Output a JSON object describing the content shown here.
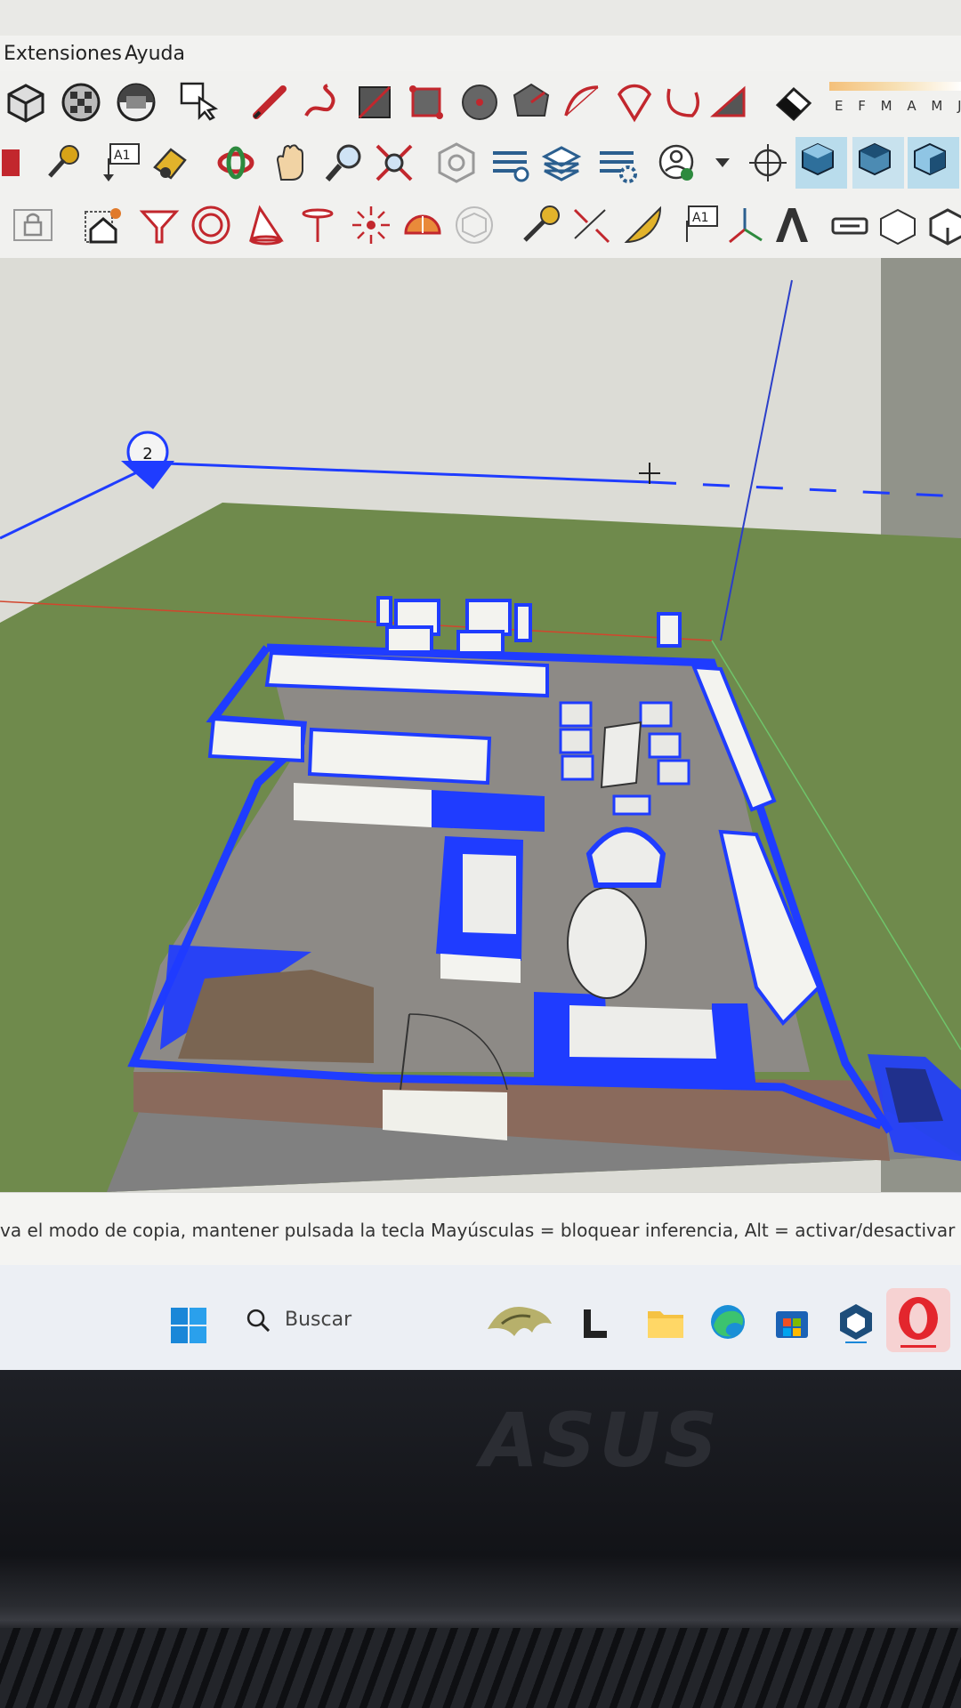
{
  "menu": {
    "items": [
      "Extensiones",
      "Ayuda"
    ]
  },
  "toolbars": {
    "month_labels": "E F M A M J",
    "row1_icons": [
      "section-box-icon",
      "materials-icon",
      "styles-icon",
      "select-icon",
      "pencil-icon",
      "freehand-icon",
      "rectangle-icon",
      "rotated-rectangle-icon",
      "circle-icon",
      "polygon-icon",
      "arc-icon",
      "pie-icon",
      "two-point-arc-icon",
      "three-point-arc-icon",
      "eraser-icon"
    ],
    "row2_icons": [
      "paint-bucket-icon",
      "text-icon",
      "paint-icon",
      "orbit-icon",
      "pan-icon",
      "zoom-icon",
      "zoom-extents-icon",
      "warehouse-icon",
      "layers-icon",
      "extension-icon",
      "settings-icon",
      "user-account-icon",
      "camera-icon",
      "iso-view-icon",
      "top-view-icon",
      "front-view-icon"
    ],
    "row3_icons": [
      "lock-icon",
      "house-icon",
      "funnel-icon",
      "concentric-circles-icon",
      "cone-icon",
      "table-icon",
      "light-icon",
      "dome-icon",
      "cube-outline-icon",
      "tape-measure-icon",
      "dimension-icon",
      "protractor-icon",
      "text-label-icon",
      "axes-icon",
      "three-d-text-icon",
      "section-plane-icon",
      "component-icon",
      "group-icon"
    ]
  },
  "viewport": {
    "section_marker_label": "2",
    "selection_color": "#1f3cff"
  },
  "status": {
    "text": "va el modo de copia, mantener pulsada la tecla Mayúsculas = bloquear inferencia, Alt = activar/desactivar doblado a"
  },
  "taskbar": {
    "search_placeholder": "Buscar",
    "apps": [
      "start-icon",
      "search-icon",
      "widget-icon",
      "sketchup-layout-icon",
      "file-explorer-icon",
      "edge-icon",
      "store-icon",
      "sketchup-icon",
      "opera-icon"
    ]
  },
  "brand": {
    "logo": "ASUS"
  }
}
